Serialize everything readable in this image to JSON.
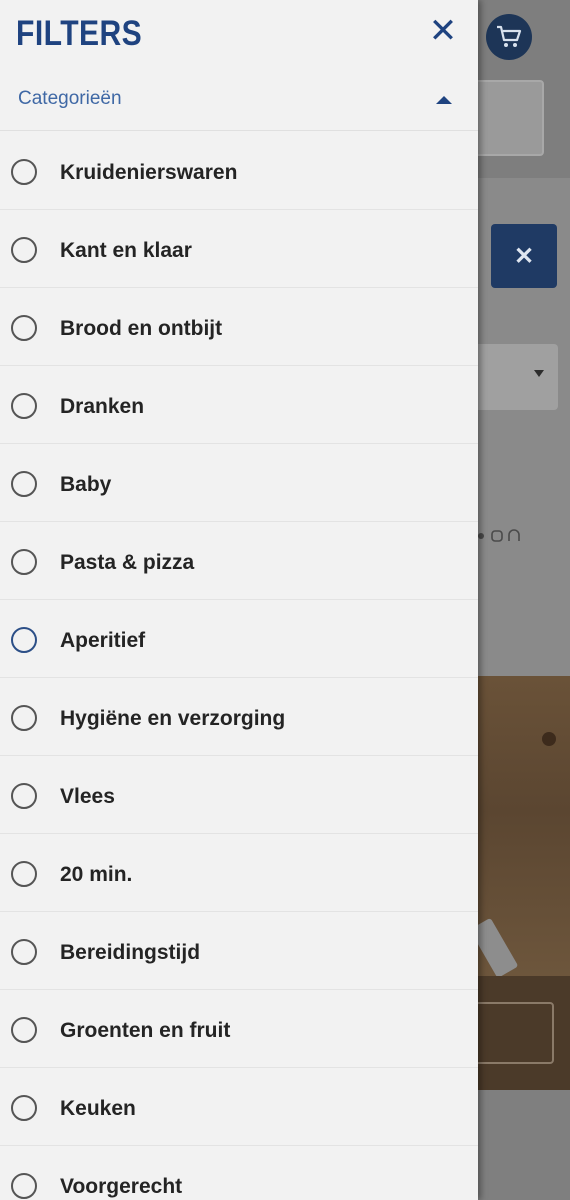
{
  "panel": {
    "title": "FILTERS",
    "close_icon": "close-icon",
    "category_header": "Categorieën",
    "category_state": "expanded",
    "options": [
      {
        "label": "Kruidenierswaren",
        "checked": false
      },
      {
        "label": "Kant en klaar",
        "checked": false
      },
      {
        "label": "Brood en ontbijt",
        "checked": false
      },
      {
        "label": "Dranken",
        "checked": false
      },
      {
        "label": "Baby",
        "checked": false
      },
      {
        "label": "Pasta & pizza",
        "checked": false
      },
      {
        "label": "Aperitief",
        "checked": false
      },
      {
        "label": "Hygiëne en verzorging",
        "checked": false
      },
      {
        "label": "Vlees",
        "checked": false
      },
      {
        "label": "20 min.",
        "checked": false
      },
      {
        "label": "Bereidingstijd",
        "checked": false
      },
      {
        "label": "Groenten en fruit",
        "checked": false
      },
      {
        "label": "Keuken",
        "checked": false
      },
      {
        "label": "Voorgerecht",
        "checked": false
      }
    ]
  },
  "background": {
    "cart_icon": "cart-icon",
    "chip_close_icon": "close-icon",
    "select_icon": "chevron-down-icon"
  },
  "colors": {
    "brand_blue": "#1f4380",
    "panel_bg": "#f2f2f2",
    "category_text": "#3f68a5"
  }
}
